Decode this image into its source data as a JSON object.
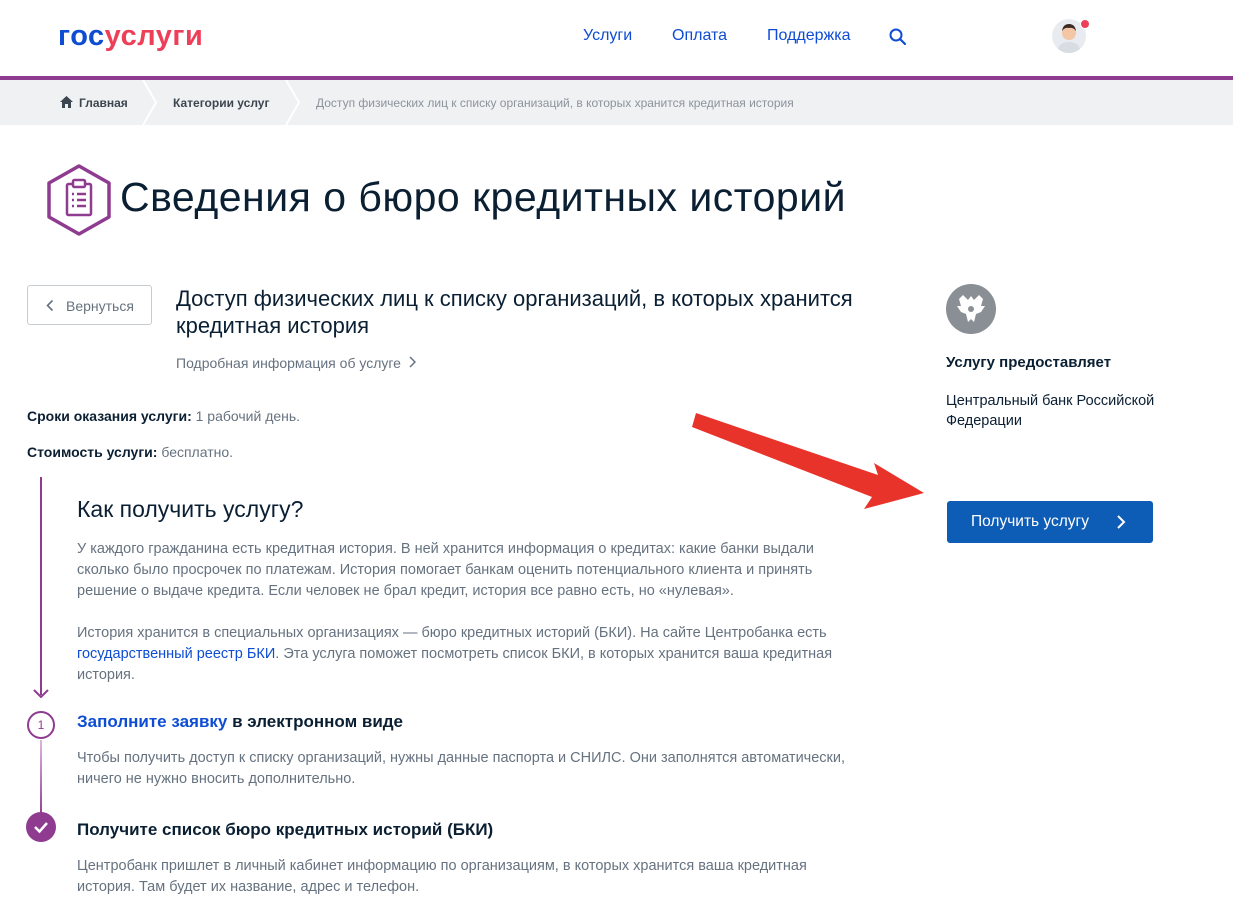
{
  "header": {
    "logo_part1": "гос",
    "logo_part2": "услуги",
    "nav": [
      "Услуги",
      "Оплата",
      "Поддержка"
    ],
    "colors": {
      "brand_blue": "#0d4cd3",
      "brand_red": "#ee3f58",
      "accent_purple": "#8f3b8f"
    }
  },
  "breadcrumb": {
    "home": "Главная",
    "categories": "Категории услуг",
    "current": "Доступ физических лиц к списку организаций, в которых хранится кредитная история"
  },
  "page": {
    "title": "Сведения о бюро кредитных историй",
    "back_label": "Вернуться",
    "service_title": "Доступ физических лиц к списку организаций, в которых хранится кредитная история",
    "more_info": "Подробная информация об услуге",
    "terms_label": "Сроки оказания услуги:",
    "terms_value": " 1 рабочий день.",
    "cost_label": "Стоимость услуги:",
    "cost_value": " бесплатно."
  },
  "how": {
    "title": "Как получить услугу?",
    "p1": "У каждого гражданина есть кредитная история. В ней хранится информация о кредитах: какие банки выдали сколько было просрочек по платежам. История помогает банкам оценить потенциального клиента и принять решение о выдаче кредита. Если человек не брал кредит, история все равно есть, но «нулевая».",
    "p2_before": "История хранится в специальных организациях — бюро кредитных историй (БКИ). На сайте Центробанка есть ",
    "p2_link": "государственный реестр БКИ",
    "p2_after": ". Эта услуга поможет посмотреть список БКИ, в которых хранится ваша кредитная история.",
    "steps": [
      {
        "num": "1",
        "title_link": "Заполните заявку",
        "title_rest": " в электронном виде",
        "text": "Чтобы получить доступ к списку организаций, нужны данные паспорта и СНИЛС. Они заполнятся автоматически, ничего не нужно вносить дополнительно."
      },
      {
        "title": "Получите список бюро кредитных историй (БКИ)",
        "text": "Центробанк пришлет в личный кабинет информацию по организациям, в которых хранится ваша кредитная история. Там будет их название, адрес и телефон."
      }
    ]
  },
  "sidebar": {
    "provider_label": "Услугу предоставляет",
    "provider_name": "Центральный банк Российской Федерации",
    "get_button": "Получить услугу"
  }
}
